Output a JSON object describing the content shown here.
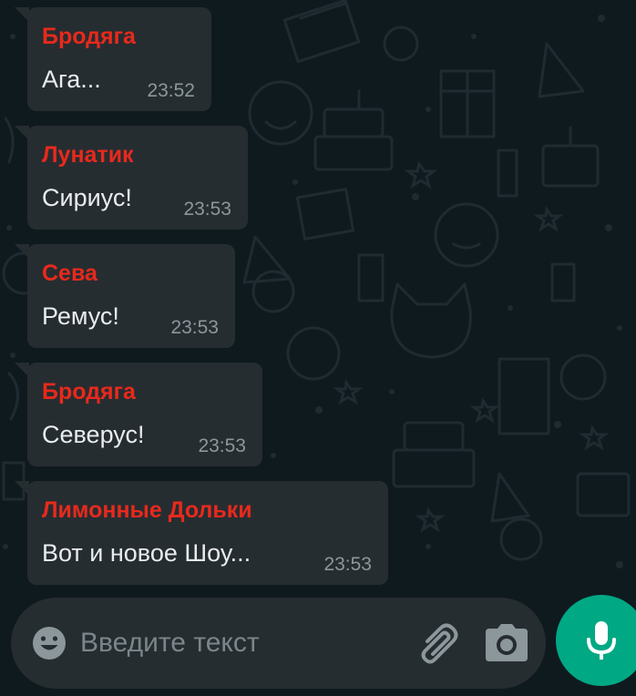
{
  "messages": [
    {
      "sender": "Бродяга",
      "text": "Ага...",
      "time": "23:52"
    },
    {
      "sender": "Лунатик",
      "text": "Сириус!",
      "time": "23:53"
    },
    {
      "sender": "Сева",
      "text": "Ремус!",
      "time": "23:53"
    },
    {
      "sender": "Бродяга",
      "text": "Северус!",
      "time": "23:53"
    },
    {
      "sender": "Лимонные Дольки",
      "text": "Вот и новое Шоу...",
      "time": "23:53"
    }
  ],
  "composer": {
    "placeholder": "Введите текст",
    "emoji_icon": "emoji-icon",
    "attach_icon": "paperclip-icon",
    "camera_icon": "camera-icon"
  },
  "mic_button": {
    "icon": "microphone-icon"
  },
  "colors": {
    "background": "#0f1a1f",
    "bubble": "#262d31",
    "sender_name": "#e8291c",
    "message_text": "#e9ecee",
    "timestamp": "#8c979c",
    "accent": "#00a884"
  }
}
